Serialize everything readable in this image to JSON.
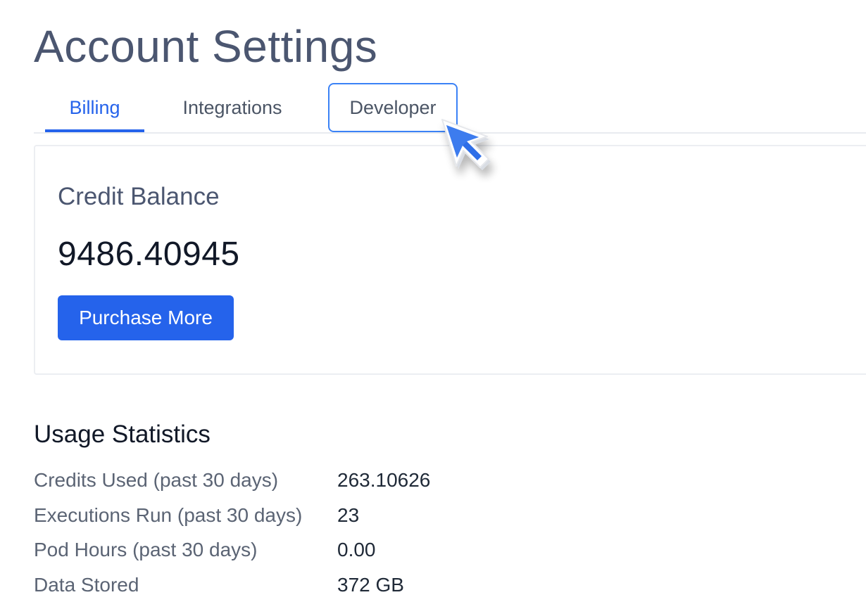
{
  "header": {
    "title": "Account Settings"
  },
  "tabs": [
    {
      "label": "Billing",
      "state": "active"
    },
    {
      "label": "Integrations",
      "state": "default"
    },
    {
      "label": "Developer",
      "state": "focused"
    }
  ],
  "credit_card": {
    "title": "Credit Balance",
    "balance": "9486.40945",
    "purchase_label": "Purchase More"
  },
  "usage": {
    "title": "Usage Statistics",
    "rows": [
      {
        "label": "Credits Used (past 30 days)",
        "value": "263.10626"
      },
      {
        "label": "Executions Run (past 30 days)",
        "value": "23"
      },
      {
        "label": "Pod Hours (past 30 days)",
        "value": "0.00"
      },
      {
        "label": "Data Stored",
        "value": "372 GB"
      }
    ]
  },
  "colors": {
    "accent": "#2563eb",
    "title": "#4b5670",
    "focus_ring": "#3b82f6"
  },
  "icons": {
    "cursor": "mouse-pointer-icon"
  }
}
